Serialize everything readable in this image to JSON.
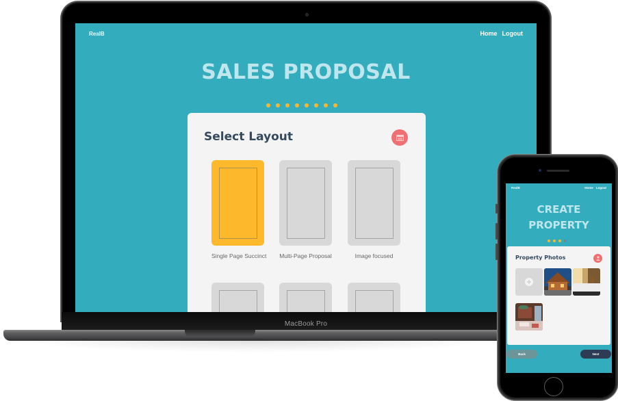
{
  "laptop": {
    "device_label": "MacBook Pro",
    "app": {
      "brand": "RealB",
      "nav": [
        "Home",
        "Logout"
      ],
      "title": "SALES PROPOSAL",
      "progress": {
        "total_steps": 8,
        "completed_steps": 8
      },
      "card": {
        "title": "Select Layout",
        "icon": "layout-icon",
        "layouts": [
          {
            "label": "Single Page Succinct",
            "selected": true
          },
          {
            "label": "Multi-Page Proposal",
            "selected": false
          },
          {
            "label": "Image focused",
            "selected": false
          },
          {
            "label": "",
            "selected": false
          },
          {
            "label": "",
            "selected": false
          },
          {
            "label": "",
            "selected": false
          }
        ]
      }
    }
  },
  "phone": {
    "app": {
      "brand": "RealB",
      "nav": [
        "Home",
        "Logout"
      ],
      "title_line1": "CREATE",
      "title_line2": "PROPERTY",
      "progress": {
        "total_steps": 4,
        "completed_steps": 3
      },
      "card": {
        "title": "Property Photos",
        "icon": "user-icon",
        "add_photo_icon": "plus-circle-icon",
        "photos": [
          "cabin-exterior-photo",
          "kitchen-counter-photo",
          "living-room-photo"
        ]
      },
      "buttons": {
        "back": "Back",
        "next": "Next"
      }
    }
  },
  "colors": {
    "primary": "#33adbd",
    "accent": "#fdb92b",
    "title_text": "#bfe6ec",
    "heading": "#34495e",
    "icon_bg": "#ef6f72",
    "next_button": "#2e3b55",
    "back_button": "#6c9599"
  }
}
